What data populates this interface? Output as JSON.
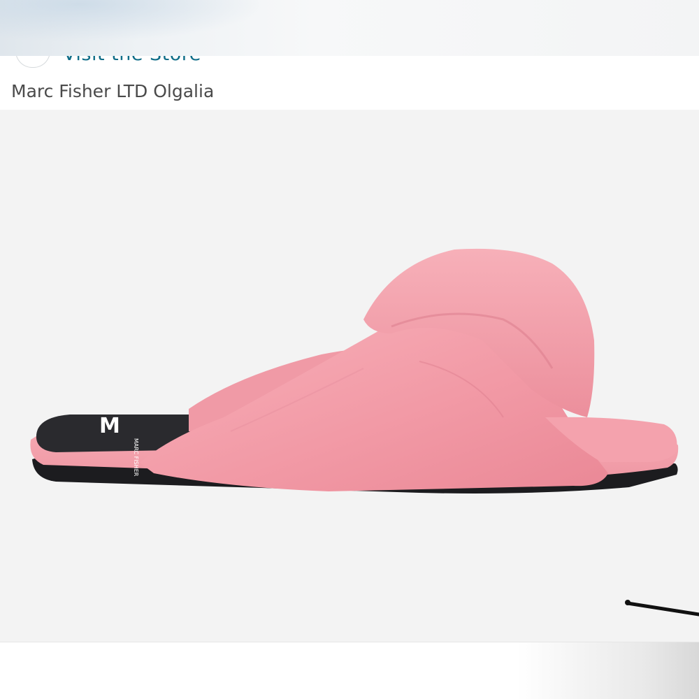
{
  "store": {
    "link_label": "Visit the Store"
  },
  "product": {
    "title": "Marc Fisher LTD Olgalia",
    "image_icon": "product-photo",
    "sole_logo_letter": "M",
    "colors": {
      "strap": "#f4a3ad",
      "footbed": "#2a2a2e",
      "background": "#f3f3f3",
      "link": "#0f6d88"
    }
  }
}
